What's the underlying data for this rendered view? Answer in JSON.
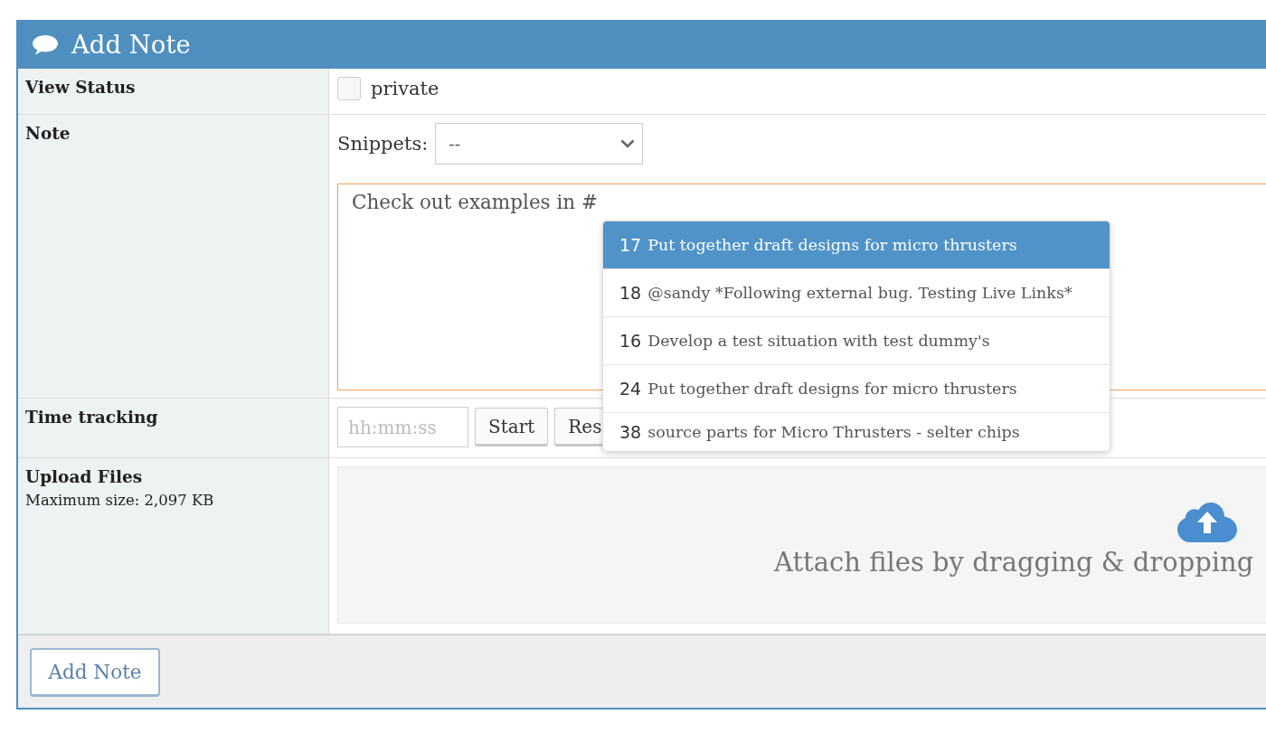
{
  "panel": {
    "title": "Add Note"
  },
  "rows": [
    {
      "kind": "checkbox",
      "label": "View Status",
      "checkbox": {
        "label": "private",
        "checked": false
      }
    },
    {
      "kind": "note",
      "label": "Note",
      "snippets": {
        "label": "Snippets:",
        "value": "--"
      },
      "textarea": {
        "value": "Check out examples in #"
      },
      "suggestions": [
        {
          "number": "17",
          "title": "Put together draft designs for micro thrusters",
          "selected": true
        },
        {
          "number": "18",
          "title": "@sandy *Following external bug. Testing Live Links*",
          "selected": false
        },
        {
          "number": "16",
          "title": "Develop a test situation with test dummy's",
          "selected": false
        },
        {
          "number": "24",
          "title": "Put together draft designs for micro thrusters",
          "selected": false
        },
        {
          "number": "38",
          "title": "source parts for Micro Thrusters - selter chips",
          "selected": false
        }
      ]
    },
    {
      "kind": "time",
      "label": "Time tracking",
      "input": {
        "placeholder": "hh:mm:ss"
      },
      "buttons": [
        "Start",
        "Res"
      ]
    },
    {
      "kind": "upload",
      "label": "Upload Files",
      "hint": "Maximum size: 2,097 KB",
      "dropzone": {
        "text": "Attach files by dragging & dropping"
      }
    }
  ],
  "footer": {
    "button": "Add Note"
  }
}
